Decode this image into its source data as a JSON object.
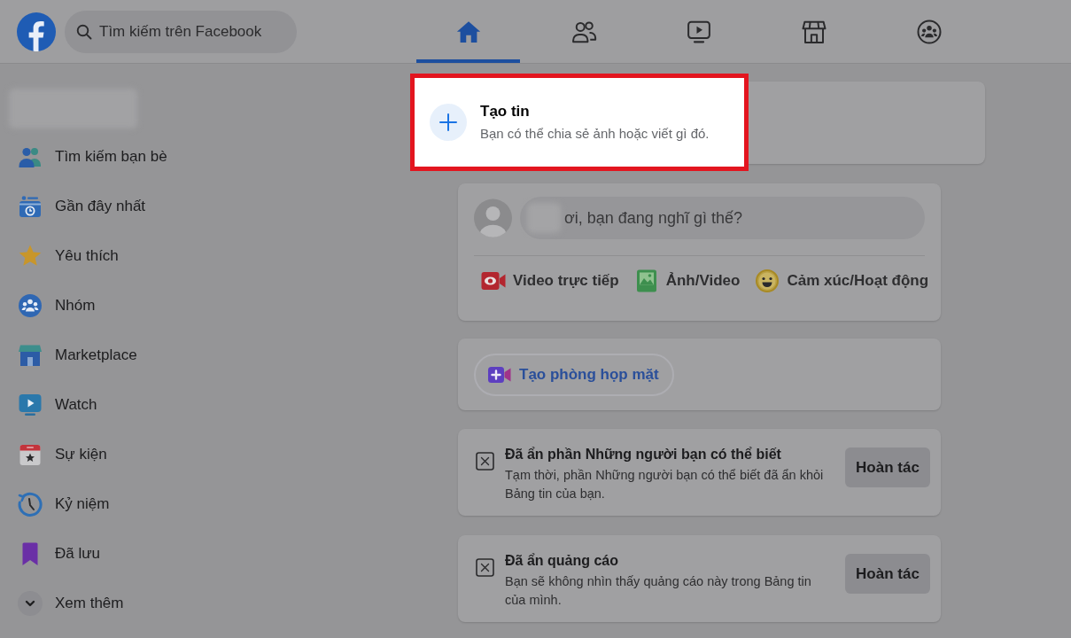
{
  "top_bar": {
    "search": {
      "placeholder": "Tìm kiếm trên Facebook"
    },
    "nav_tabs": [
      {
        "kind": "home",
        "selected": true
      },
      {
        "kind": "friends",
        "selected": false
      },
      {
        "kind": "watch",
        "selected": false
      },
      {
        "kind": "marketplace",
        "selected": false
      },
      {
        "kind": "groups",
        "selected": false
      }
    ]
  },
  "sidebar": {
    "items": [
      {
        "kind": "friends",
        "label": "Tìm kiếm bạn bè"
      },
      {
        "kind": "recent",
        "label": "Gần đây nhất"
      },
      {
        "kind": "favorites",
        "label": "Yêu thích"
      },
      {
        "kind": "groups",
        "label": "Nhóm"
      },
      {
        "kind": "marketplace",
        "label": "Marketplace"
      },
      {
        "kind": "watch",
        "label": "Watch"
      },
      {
        "kind": "events",
        "label": "Sự kiện"
      },
      {
        "kind": "memories",
        "label": "Kỷ niệm"
      },
      {
        "kind": "saved",
        "label": "Đã lưu"
      },
      {
        "kind": "more",
        "label": "Xem thêm"
      }
    ]
  },
  "create_story": {
    "title": "Tạo tin",
    "subtitle": "Bạn có thể chia sẻ ảnh hoặc viết gì đó.",
    "highlighted": true
  },
  "composer": {
    "placeholder": "ơi, bạn đang nghĩ gì thế?",
    "actions": [
      {
        "kind": "live_video",
        "label": "Video trực tiếp"
      },
      {
        "kind": "photo",
        "label": "Ảnh/Video"
      },
      {
        "kind": "feeling",
        "label": "Cảm xúc/Hoạt động"
      }
    ]
  },
  "room": {
    "label": "Tạo phòng họp mặt"
  },
  "hidden_notices": [
    {
      "title": "Đã ẩn phần Những người bạn có thể biết",
      "body": "Tạm thời, phần Những người bạn có thể biết đã ẩn khỏi Bảng tin của bạn.",
      "button": "Hoàn tác"
    },
    {
      "title": "Đã ẩn quảng cáo",
      "body": "Bạn sẽ không nhìn thấy quảng cáo này trong Bảng tin của mình.",
      "button": "Hoàn tác"
    }
  ]
}
